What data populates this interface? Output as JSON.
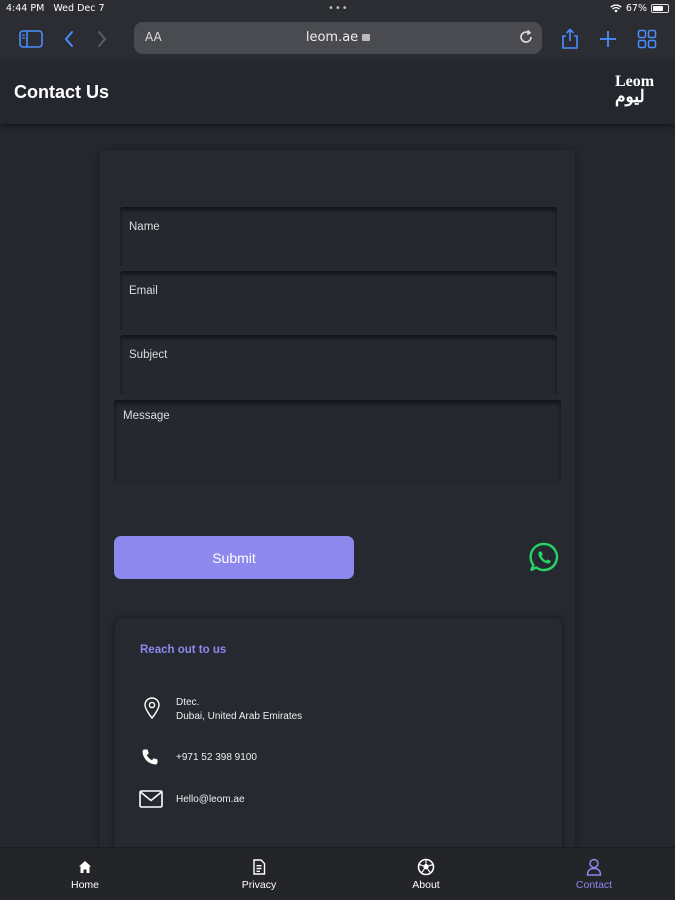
{
  "status_bar": {
    "time": "4:44 PM",
    "date": "Wed Dec 7",
    "battery": "67%",
    "battery_level": 0.67
  },
  "browser": {
    "aa_label": "AA",
    "url": "leom.ae",
    "accent_color": "#4a8dff"
  },
  "header": {
    "title": "Contact Us",
    "logo_line1": "Leom",
    "logo_line2": "ليوم"
  },
  "form": {
    "name_placeholder": "Name",
    "email_placeholder": "Email",
    "subject_placeholder": "Subject",
    "message_placeholder": "Message",
    "submit_label": "Submit",
    "accent_color": "#8c88ee"
  },
  "contact_info": {
    "title": "Reach out to us",
    "address_line1": "Dtec.",
    "address_line2": "Dubai, United Arab Emirates",
    "phone": "+971 52 398 9100",
    "email": "Hello@leom.ae"
  },
  "bottom_nav": {
    "items": [
      {
        "label": "Home",
        "icon": "home-icon"
      },
      {
        "label": "Privacy",
        "icon": "document-icon"
      },
      {
        "label": "About",
        "icon": "soccer-ball-icon"
      },
      {
        "label": "Contact",
        "icon": "user-icon",
        "active": true
      }
    ]
  }
}
